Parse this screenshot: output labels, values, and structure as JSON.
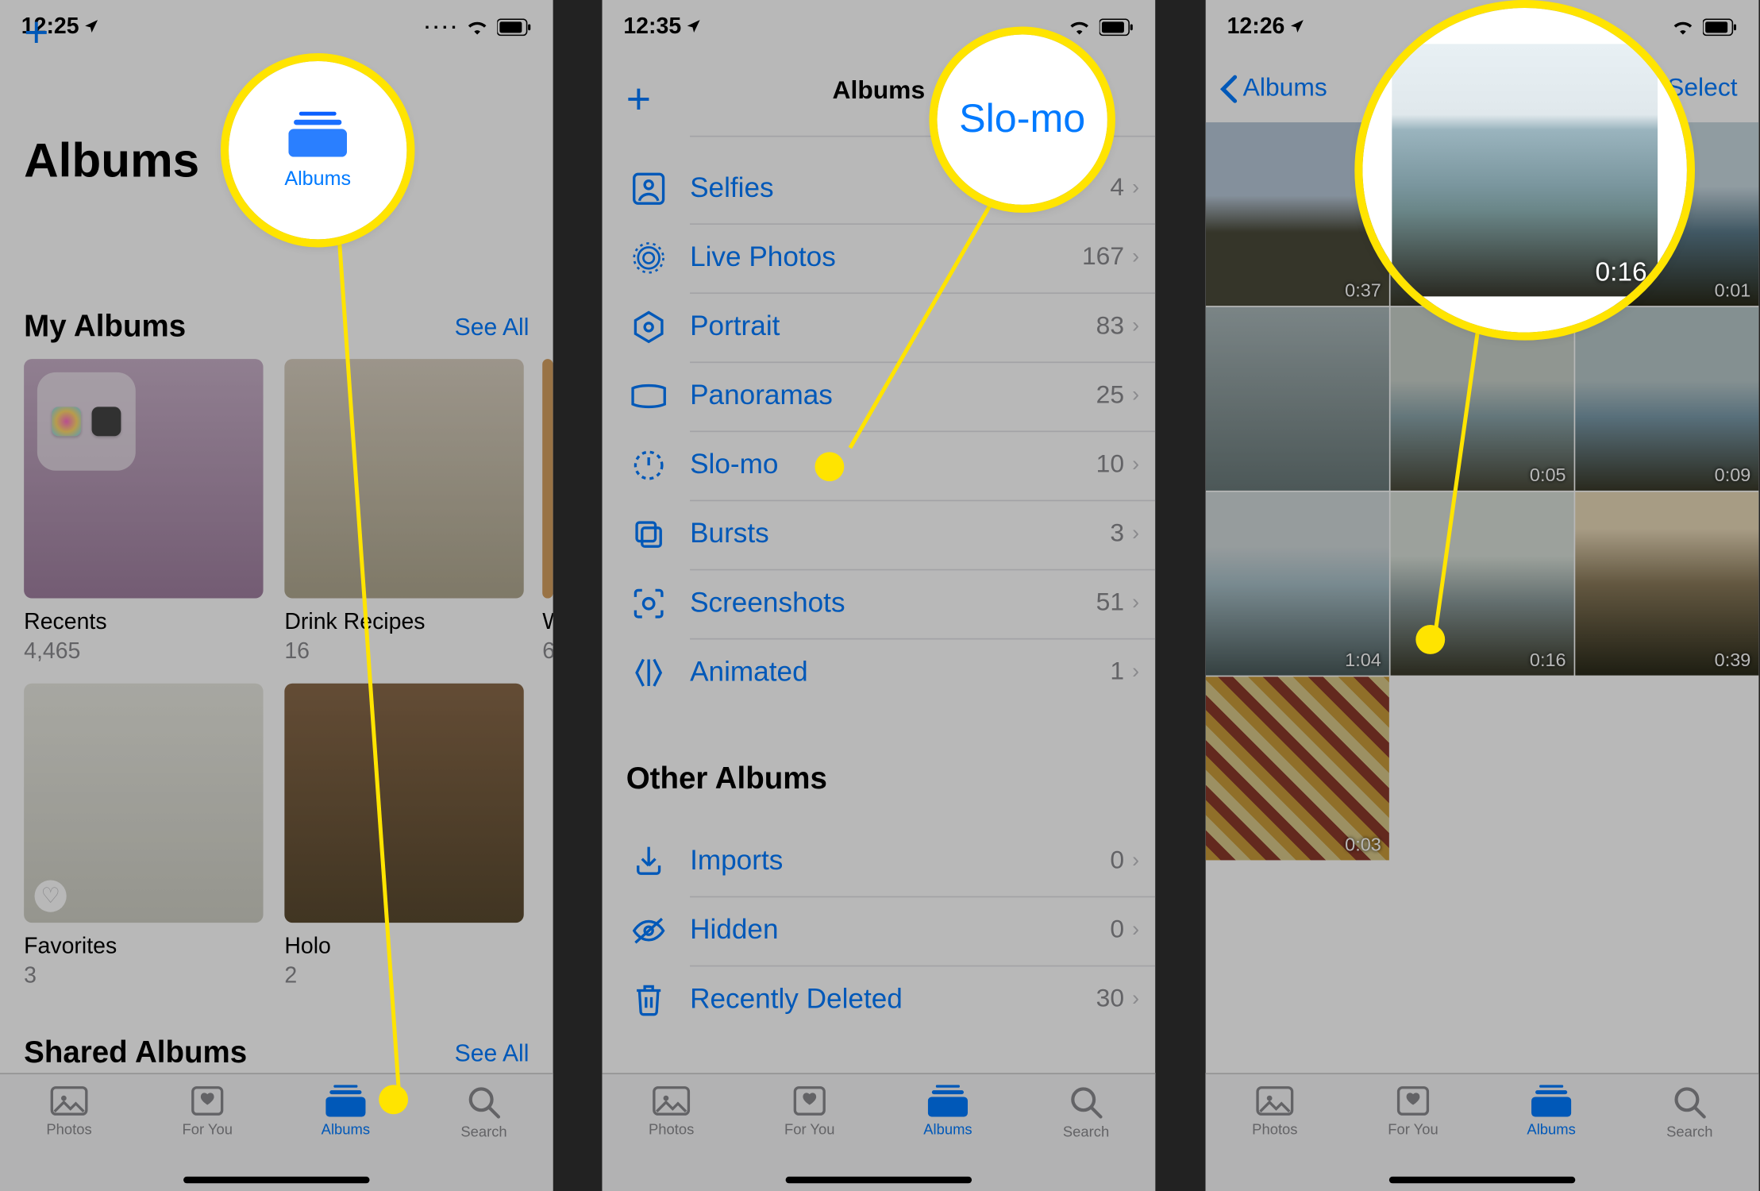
{
  "screen1": {
    "status": {
      "time": "12:25",
      "showDots": true
    },
    "add": "+",
    "title": "Albums",
    "sections": {
      "myAlbums": {
        "title": "My Albums",
        "seeAll": "See All"
      },
      "sharedAlbums": {
        "title": "Shared Albums",
        "seeAll": "See All"
      }
    },
    "albums": {
      "recents": {
        "label": "Recents",
        "count": "4,465"
      },
      "drink": {
        "label": "Drink Recipes",
        "count": "16"
      },
      "w": {
        "label": "W",
        "count": "6"
      },
      "favorites": {
        "label": "Favorites",
        "count": "3"
      },
      "holo": {
        "label": "Holo",
        "count": "2"
      }
    },
    "highlight": {
      "label": "Albums"
    }
  },
  "screen2": {
    "status": {
      "time": "12:35",
      "showDots": false
    },
    "add": "+",
    "title": "Albums",
    "rows": {
      "selfies": {
        "label": "Selfies",
        "count": "4"
      },
      "livePhotos": {
        "label": "Live Photos",
        "count": "167"
      },
      "portrait": {
        "label": "Portrait",
        "count": "83"
      },
      "panoramas": {
        "label": "Panoramas",
        "count": "25"
      },
      "slomo": {
        "label": "Slo-mo",
        "count": "10"
      },
      "bursts": {
        "label": "Bursts",
        "count": "3"
      },
      "screenshots": {
        "label": "Screenshots",
        "count": "51"
      },
      "animated": {
        "label": "Animated",
        "count": "1"
      },
      "imports": {
        "label": "Imports",
        "count": "0"
      },
      "hidden": {
        "label": "Hidden",
        "count": "0"
      },
      "recentlyDeleted": {
        "label": "Recently Deleted",
        "count": "30"
      }
    },
    "otherAlbums": "Other Albums",
    "highlight": {
      "label": "Slo-mo"
    }
  },
  "screen3": {
    "status": {
      "time": "12:26",
      "showDots": false
    },
    "back": "Albums",
    "select": "Select",
    "durations": {
      "r1c1": "0:37",
      "r1c2": "0:16",
      "r1c3": "0:01",
      "r2c1": "",
      "r2c2": "0:05",
      "r2c3": "0:09",
      "r3c1": "1:04",
      "r3c2": "0:16",
      "r3c3": "0:39",
      "r4c1": "0:03"
    },
    "highlight": {
      "label": "0:16"
    }
  },
  "tabs": {
    "photos": "Photos",
    "forYou": "For You",
    "albums": "Albums",
    "search": "Search"
  }
}
